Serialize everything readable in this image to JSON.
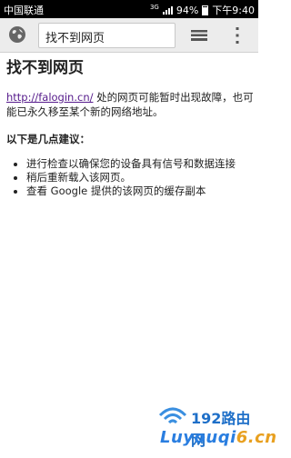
{
  "status_bar": {
    "carrier": "中国联通",
    "network": "3G",
    "battery": "94%",
    "time": "下午9:40"
  },
  "toolbar": {
    "url_text": "找不到网页"
  },
  "page": {
    "title": "找不到网页",
    "link_text": "http://falogin.cn/",
    "description": " 处的网页可能暂时出现故障，也可能已永久移至某个新的网络地址。",
    "suggestions_heading": "以下是几点建议：",
    "suggestions": [
      "进行检查以确保您的设备具有信号和数据连接",
      "稍后重新载入该网页。",
      "查看 Google 提供的该网页的缓存副本"
    ]
  },
  "watermark": {
    "brand": "192路由网",
    "domain_prefix": "Luyouqi",
    "domain_suffix": "6.cn"
  },
  "colors": {
    "link": "#551a8b",
    "toolbar_bg": "#ececec",
    "status_bar_bg": "#000000",
    "watermark_blue": "#1e6fc8"
  }
}
